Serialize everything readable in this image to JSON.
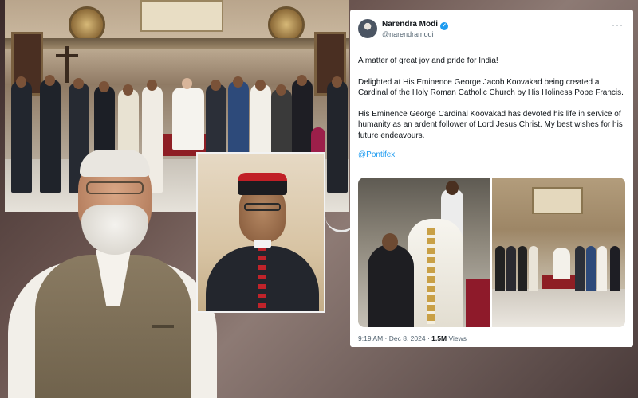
{
  "background": {
    "group_photo_plaque_text": "",
    "colors": {
      "carpet_red": "#8e1e24",
      "tweet_bg": "#ffffff",
      "link_blue": "#1d9bf0"
    }
  },
  "tweet": {
    "author_name": "Narendra Modi",
    "author_handle": "@narendramodi",
    "verified": true,
    "more_icon": "ellipsis-icon",
    "paragraphs": [
      "A matter of great joy and pride for India!",
      "Delighted at His Eminence George Jacob Koovakad being created a Cardinal of the Holy Roman Catholic Church by His Holiness Pope Francis.",
      "His Eminence George Cardinal Koovakad has devoted his life in service of humanity as an ardent follower of Lord Jesus Christ. My best wishes for his future endeavours."
    ],
    "mention": "@Pontifex",
    "timestamp": "9:19 AM · Dec 8, 2024 ·",
    "views_count": "1.5M",
    "views_label": "Views"
  }
}
